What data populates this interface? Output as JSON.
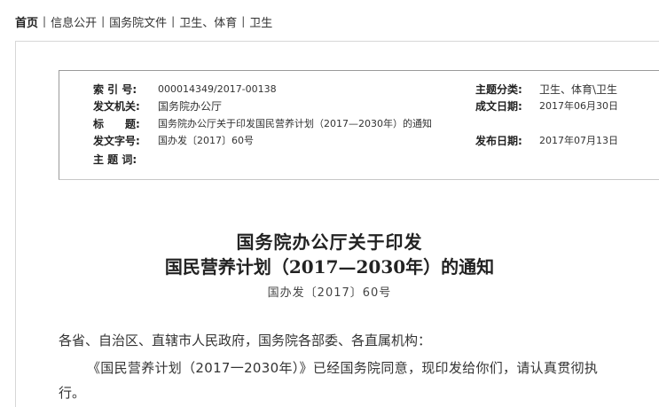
{
  "breadcrumb": {
    "home": "首页",
    "items": [
      "信息公开",
      "国务院文件",
      "卫生、体育",
      "卫生"
    ],
    "separator": "|"
  },
  "info": {
    "index_label": "索 引 号:",
    "index_value": "000014349/2017-00138",
    "topic_label": "主题分类:",
    "topic_value": "卫生、体育\\卫生",
    "issuer_label": "发文机关:",
    "issuer_value": "国务院办公厅",
    "created_label": "成文日期:",
    "created_value": "2017年06月30日",
    "title_label": "标　　题:",
    "title_value": "国务院办公厅关于印发国民营养计划（2017—2030年）的通知",
    "docnum_label": "发文字号:",
    "docnum_value": "国办发〔2017〕60号",
    "published_label": "发布日期:",
    "published_value": "2017年07月13日",
    "keywords_label": "主 题 词:",
    "keywords_value": ""
  },
  "document": {
    "title_line1": "国务院办公厅关于印发",
    "title_line2": "国民营养计划（2017—2030年）的通知",
    "doc_number": "国办发〔2017〕60号",
    "paragraphs": [
      "各省、自治区、直辖市人民政府，国务院各部委、各直属机构：",
      "《国民营养计划（2017一2030年）》已经国务院同意，现印发给你们，请认真贯彻执",
      "行。"
    ]
  }
}
